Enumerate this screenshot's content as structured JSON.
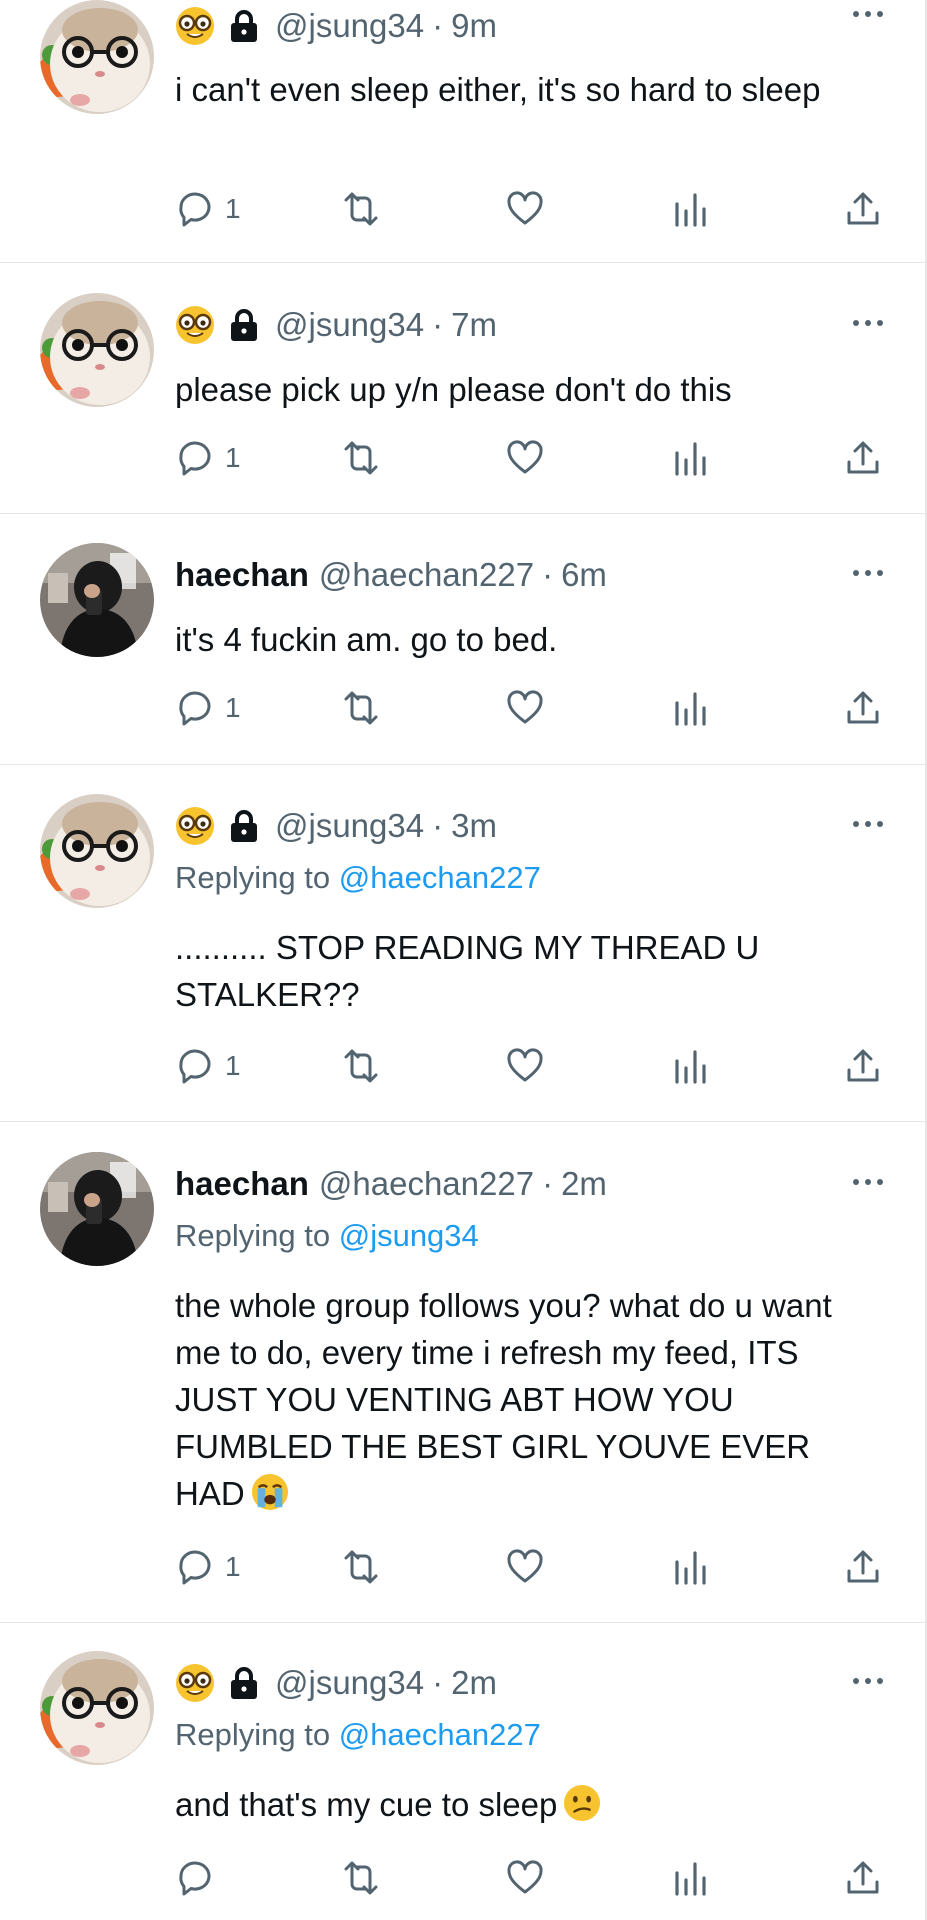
{
  "tweets": [
    {
      "id": "t1",
      "avatar": "hamster-glasses",
      "name": "",
      "handle": "@jsung34",
      "time": "9m",
      "replying_to": "",
      "text": "i can't even sleep either, it's so hard to sleep",
      "reply_count": "1",
      "icons": [
        "nerd-face-emoji",
        "lock-icon"
      ]
    },
    {
      "id": "t2",
      "avatar": "hamster-glasses",
      "name": "",
      "handle": "@jsung34",
      "time": "7m",
      "replying_to": "",
      "text": "please pick up y/n please don't do this",
      "reply_count": "1",
      "icons": [
        "nerd-face-emoji",
        "lock-icon"
      ]
    },
    {
      "id": "t3",
      "avatar": "person-mirror-selfie",
      "name": "haechan",
      "handle": "@haechan227",
      "time": "6m",
      "replying_to": "",
      "text": "it's 4 fuckin am. go to bed.",
      "reply_count": "1",
      "icons": []
    },
    {
      "id": "t4",
      "avatar": "hamster-glasses",
      "name": "",
      "handle": "@jsung34",
      "time": "3m",
      "replying_to_label": "Replying to",
      "replying_to": "@haechan227",
      "text": ".......... STOP READING MY THREAD U STALKER??",
      "reply_count": "1",
      "icons": [
        "nerd-face-emoji",
        "lock-icon"
      ]
    },
    {
      "id": "t5",
      "avatar": "person-mirror-selfie",
      "name": "haechan",
      "handle": "@haechan227",
      "time": "2m",
      "replying_to_label": "Replying to",
      "replying_to": "@jsung34",
      "text": "the whole group follows you? what do u want me to do, every time i refresh my feed, ITS JUST YOU VENTING ABT HOW YOU FUMBLED THE BEST GIRL YOUVE EVER HAD",
      "reply_count": "1",
      "icons": [
        "loudly-crying-emoji"
      ]
    },
    {
      "id": "t6",
      "avatar": "hamster-glasses",
      "name": "",
      "handle": "@jsung34",
      "time": "2m",
      "replying_to_label": "Replying to",
      "replying_to": "@haechan227",
      "text": "and that's my cue to sleep",
      "reply_count": "",
      "icons": [
        "nerd-face-emoji",
        "lock-icon",
        "confused-face-emoji"
      ]
    }
  ],
  "separator": "·",
  "colors": {
    "text": "#0f1419",
    "muted": "#536471",
    "link": "#1d9bf0",
    "divider": "#e7e7e7"
  }
}
